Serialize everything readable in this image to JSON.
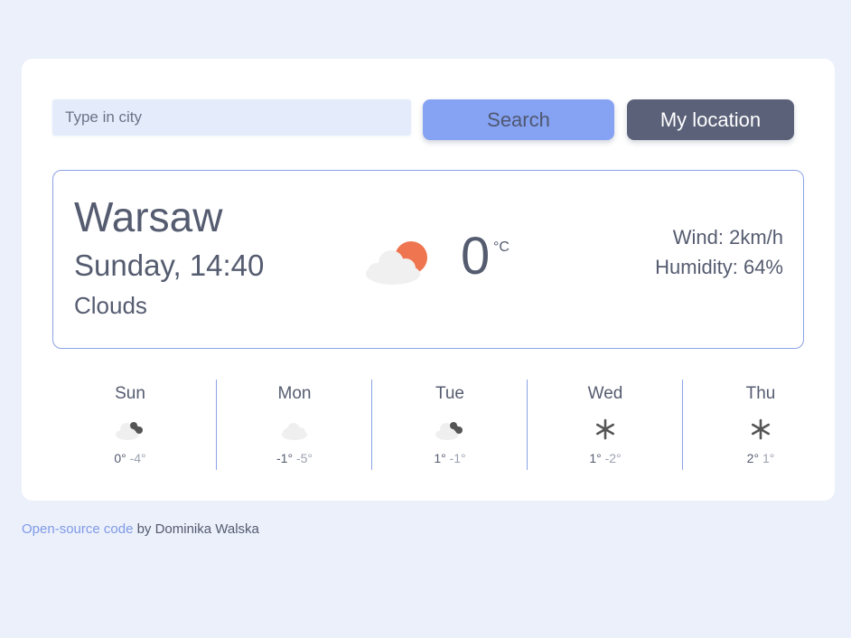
{
  "search": {
    "placeholder": "Type in city",
    "value": ""
  },
  "buttons": {
    "search_label": "Search",
    "location_label": "My location"
  },
  "current": {
    "city": "Warsaw",
    "datetime": "Sunday, 14:40",
    "description": "Clouds",
    "temperature": "0",
    "unit": "°C",
    "wind": "Wind: 2km/h",
    "humidity": "Humidity: 64%",
    "icon": "cloud-sun-icon"
  },
  "forecast": [
    {
      "day": "Sun",
      "max": "0°",
      "min": "-4°",
      "icon": "cloud-dark-icon"
    },
    {
      "day": "Mon",
      "max": "-1°",
      "min": "-5°",
      "icon": "cloud-icon"
    },
    {
      "day": "Tue",
      "max": "1°",
      "min": "-1°",
      "icon": "cloud-dark-icon"
    },
    {
      "day": "Wed",
      "max": "1°",
      "min": "-2°",
      "icon": "snowflake-icon"
    },
    {
      "day": "Thu",
      "max": "2°",
      "min": "1°",
      "icon": "snowflake-icon"
    }
  ],
  "footer": {
    "link_text": "Open-source code",
    "text": " by Dominika Walska"
  },
  "colors": {
    "background": "#ecf0fb",
    "accent": "#86a2f3",
    "dark_button": "#5a6178",
    "border": "#8aa3e6",
    "sun": "#ef7550"
  }
}
